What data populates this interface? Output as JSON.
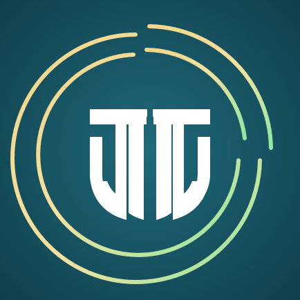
{
  "icon": {
    "logo": "tt-monogram-ring-logo",
    "colors": {
      "background_center": "#1f6a7b",
      "background_edge": "#113f4c",
      "monogram": "#ffffff",
      "ring_gold": "#f2d58a",
      "ring_pale": "#f5e2a0",
      "ring_green": "#8fe7a0"
    }
  }
}
